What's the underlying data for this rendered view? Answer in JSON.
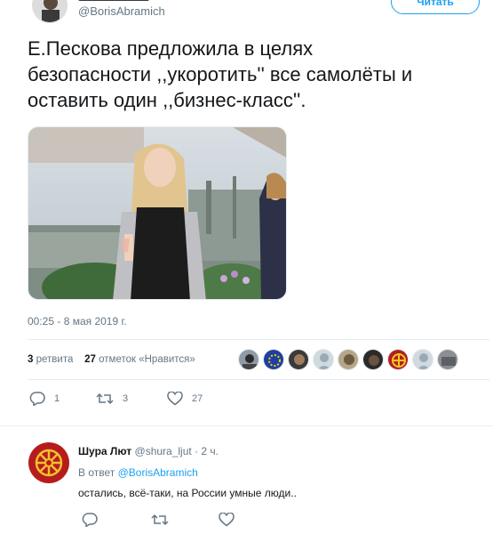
{
  "tweet": {
    "handle": "@BorisAbramich",
    "follow_label": "Читать",
    "text_lines": [
      "Е.Пескова предложила в целях",
      "безопасности ,,укоротить'' все самолёты и",
      "оставить один ,,бизнес-класс''."
    ],
    "timestamp": "00:25 - 8 мая 2019 г.",
    "retweet_count": "3",
    "retweet_label": "ретвита",
    "like_count": "27",
    "like_label": "отметок «Нравится»"
  },
  "actions": {
    "reply_count": "1",
    "retweet_count": "3",
    "like_count": "27"
  },
  "reply": {
    "name": "Шура Лют",
    "handle": "@shura_ljut",
    "time": "· 2 ч.",
    "in_reply_prefix": "В ответ",
    "in_reply_handle": "@BorisAbramich",
    "text": "остались, всё-таки, на России умные люди.."
  },
  "colors": {
    "accent": "#1da1f2",
    "muted": "#657786",
    "text": "#14171a",
    "divider": "#e6ecf0"
  },
  "icons": [
    "reply-icon",
    "retweet-icon",
    "heart-icon"
  ]
}
